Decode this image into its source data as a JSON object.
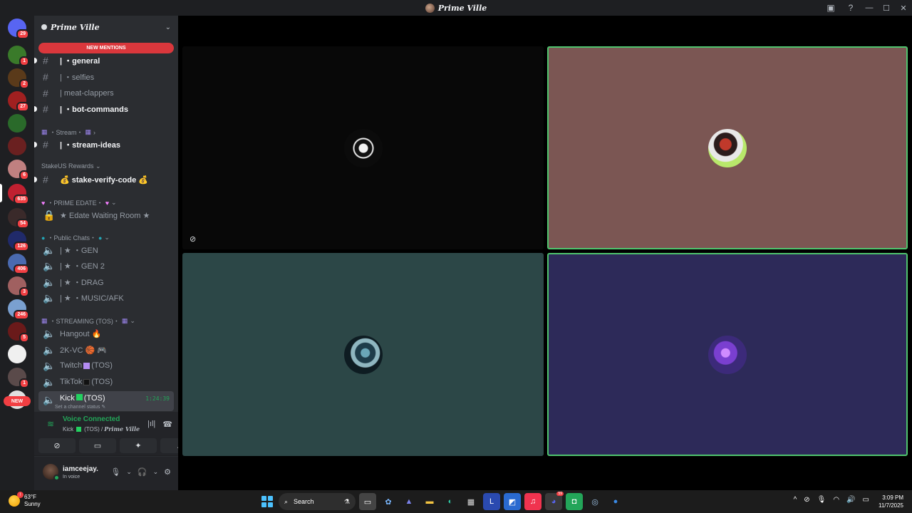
{
  "window": {
    "title": "Prime Ville",
    "controls": [
      "—",
      "☐",
      "✕"
    ]
  },
  "servers": [
    {
      "badge": "29",
      "color": "#5865f2"
    },
    {
      "badge": "1",
      "color": "#3a7a2a"
    },
    {
      "badge": "2",
      "color": "#5a3a1a"
    },
    {
      "badge": "27",
      "color": "#a02020"
    },
    {
      "badge": "",
      "color": "#2a6a2a"
    },
    {
      "badge": "",
      "color": "#6a2020"
    },
    {
      "badge": "6",
      "color": "#c08080"
    },
    {
      "badge": "635",
      "color": "#c02030"
    },
    {
      "badge": "54",
      "color": "#3a2a2a"
    },
    {
      "badge": "126",
      "color": "#202a6a"
    },
    {
      "badge": "406",
      "color": "#4a6ab0"
    },
    {
      "badge": "3",
      "color": "#a06060"
    },
    {
      "badge": "246",
      "color": "#7aa0d0"
    },
    {
      "badge": "5",
      "color": "#6a1a1a"
    },
    {
      "badge": "",
      "color": "#f0f0f0"
    },
    {
      "badge": "1",
      "color": "#5a4a4a"
    },
    {
      "badge": "",
      "color": "#e0e0e0"
    }
  ],
  "new_pill": "NEW",
  "server": {
    "name": "Prime Ville",
    "new_mentions": "NEW MENTIONS",
    "channels": {
      "general": "|  ・general",
      "selfies": "|  ・selfies",
      "meat": "| meat-clappers",
      "bot": "|  ・bot-commands",
      "stream_ideas": "|  ・stream-ideas",
      "stake": "💰 stake-verify-code 💰",
      "edate": "★ Edate Waiting Room ★",
      "gen": "| ★ ・GEN",
      "gen2": "| ★ ・GEN 2",
      "drag": "| ★ ・DRAG",
      "music": "| ★ ・MUSIC/AFK",
      "hangout": "Hangout 🔥",
      "twok": "2K-VC 🏀 🎮",
      "twitch_a": "Twitch",
      "twitch_b": "(TOS)",
      "tiktok_a": "TikTok",
      "tiktok_b": "(TOS)",
      "kick_a": "Kick",
      "kick_b": "(TOS)",
      "kick_timer": "1:24:39",
      "kick_status": "Set a channel status ✎"
    },
    "categories": {
      "stream": "・Stream・",
      "stakeus": "StakeUS Rewards ⌄",
      "prime_edate": "・PRIME EDATE・",
      "public": "・Public Chats・",
      "streaming": "・STREAMING (TOS)・"
    }
  },
  "voice": {
    "title": "Voice Connected",
    "channel": "Kick",
    "tos": "(TOS) /",
    "server": "Prime Ville"
  },
  "user": {
    "name": "iamceejay.",
    "status": "In voice"
  },
  "taskbar": {
    "temp": "63°F",
    "condition": "Sunny",
    "search": "Search",
    "time": "3:09 PM",
    "date": "11/7/2025",
    "discord_badge": "59"
  },
  "colors": {
    "accent_green": "#23a559",
    "tile_border": "#4fc46e",
    "tile2_bg": "#7b5653",
    "tile3_bg": "#2c4747",
    "tile4_bg": "#2d2a59"
  }
}
